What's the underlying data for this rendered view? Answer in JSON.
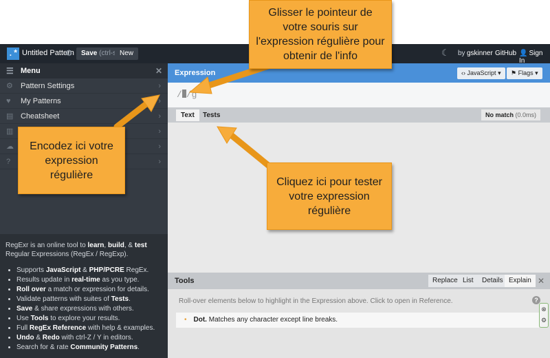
{
  "topbar": {
    "title": "Untitled Pattern",
    "save_label": "Save",
    "save_hint": "(ctrl-s)",
    "new_label": "New",
    "by_text": "by",
    "author": "gskinner",
    "github": "GitHub",
    "sign_in": "Sign In"
  },
  "sidebar": {
    "menu_title": "Menu",
    "items": [
      {
        "label": "Pattern Settings",
        "icon": "gear-icon"
      },
      {
        "label": "My Patterns",
        "icon": "heart-icon"
      },
      {
        "label": "Cheatsheet",
        "icon": "book-icon"
      },
      {
        "label": "",
        "icon": "book-icon"
      },
      {
        "label": "",
        "icon": "cloud-icon"
      },
      {
        "label": "",
        "icon": "question-icon"
      }
    ],
    "intro_parts": [
      "RegExr is an online tool to ",
      "learn",
      ", ",
      "build",
      ", & ",
      "test",
      " Regular Expressions (RegEx / RegExp)."
    ],
    "features": [
      [
        "Supports ",
        "JavaScript",
        " & ",
        "PHP/PCRE",
        " RegEx."
      ],
      [
        "Results update in ",
        "real-time",
        " as you type."
      ],
      [
        "",
        "Roll over",
        " a match or expression for details."
      ],
      [
        "Validate patterns with suites of ",
        "Tests",
        "."
      ],
      [
        "",
        "Save",
        " & share expressions with others."
      ],
      [
        "Use ",
        "Tools",
        " to explore your results."
      ],
      [
        "Full ",
        "RegEx Reference",
        " with help & examples."
      ],
      [
        "",
        "Undo",
        " & ",
        "Redo",
        " with ctrl-Z / Y in editors."
      ],
      [
        "Search for & rate ",
        "Community Patterns",
        "."
      ]
    ]
  },
  "expression": {
    "title": "Expression",
    "engine_button": "JavaScript",
    "flags_button": "Flags",
    "open_delim": "/",
    "close_delim": "/",
    "flags": "g"
  },
  "text_panel": {
    "tab_text": "Text",
    "tab_tests": "Tests",
    "match_status": "No match",
    "match_time": "(0.0ms)"
  },
  "tools": {
    "title": "Tools",
    "tabs": [
      "Replace",
      "List",
      "Details",
      "Explain"
    ],
    "hint": "Roll-over elements below to highlight in the Expression above. Click to open in Reference.",
    "explain_token": "Dot.",
    "explain_text": "Matches any character except line breaks."
  },
  "callouts": {
    "hover": "Glisser le pointeur de votre souris sur l'expression régulière pour obtenir de l'info",
    "encode": "Encodez ici votre expression régulière",
    "test": "Cliquez ici pour tester votre expression régulière"
  },
  "colors": {
    "accent": "#4a90d9",
    "callout": "#f7ac3b",
    "topbar": "#20262e",
    "sidebar": "#353b43"
  }
}
